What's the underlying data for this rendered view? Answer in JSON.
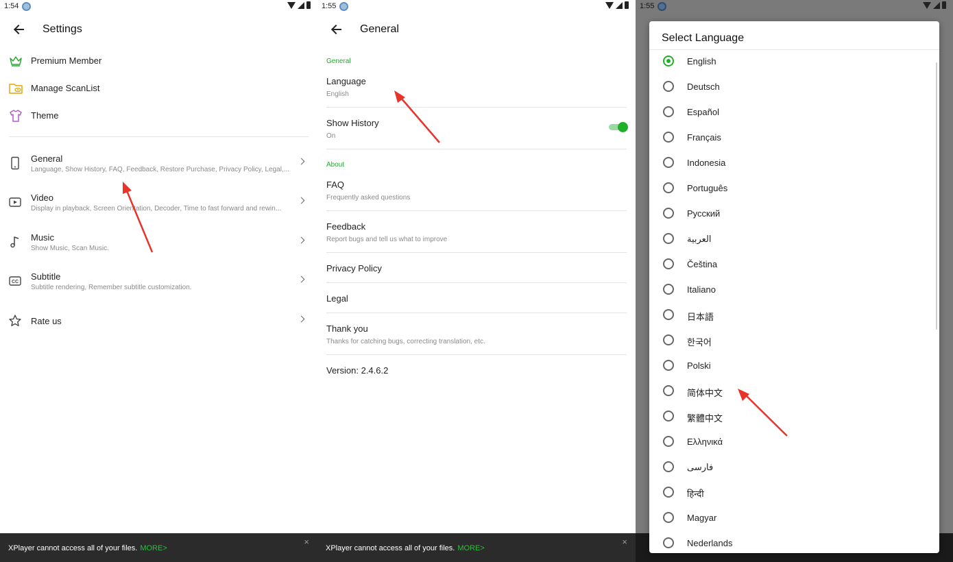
{
  "panel1": {
    "status_time": "1:54",
    "title": "Settings",
    "top_items": [
      {
        "label": "Premium Member",
        "icon": "crown-icon"
      },
      {
        "label": "Manage ScanList",
        "icon": "folder-eye-icon"
      },
      {
        "label": "Theme",
        "icon": "tshirt-icon"
      }
    ],
    "items": [
      {
        "label": "General",
        "sub": "Language, Show History, FAQ, Feedback, Restore Purchase, Privacy Policy, Legal,...",
        "icon": "phone-icon"
      },
      {
        "label": "Video",
        "sub": "Display in playback, Screen Orientation, Decoder, Time to fast forward and rewin...",
        "icon": "video-icon"
      },
      {
        "label": "Music",
        "sub": "Show Music, Scan Music.",
        "icon": "music-note-icon"
      },
      {
        "label": "Subtitle",
        "sub": "Subtitle rendering, Remember subtitle customization.",
        "icon": "cc-icon"
      },
      {
        "label": "Rate us",
        "sub": "",
        "icon": "star-icon"
      }
    ]
  },
  "panel2": {
    "status_time": "1:55",
    "title": "General",
    "section_general": "General",
    "language_label": "Language",
    "language_value": "English",
    "history_label": "Show History",
    "history_value": "On",
    "history_on": true,
    "section_about": "About",
    "faq_label": "FAQ",
    "faq_sub": "Frequently asked questions",
    "feedback_label": "Feedback",
    "feedback_sub": "Report bugs and tell us what to improve",
    "privacy_label": "Privacy Policy",
    "legal_label": "Legal",
    "thanks_label": "Thank you",
    "thanks_sub": "Thanks for catching bugs, correcting translation, etc.",
    "version": "Version: 2.4.6.2"
  },
  "panel3": {
    "status_time": "1:55",
    "dialog_title": "Select Language",
    "selected": "English",
    "languages": [
      "English",
      "Deutsch",
      "Español",
      "Français",
      "Indonesia",
      "Português",
      "Русский",
      "العربية",
      "Čeština",
      "Italiano",
      "日本語",
      "한국어",
      "Polski",
      "简体中文",
      "繁體中文",
      "Ελληνικά",
      "فارسی",
      "हिन्दी",
      "Magyar",
      "Nederlands"
    ]
  },
  "banner": {
    "text": "XPlayer cannot access all of your files.",
    "more": "MORE>",
    "close": "×"
  },
  "colors": {
    "accent": "#1fb02a",
    "arrow": "#e8332b",
    "banner_bg": "#2b2b2b"
  }
}
